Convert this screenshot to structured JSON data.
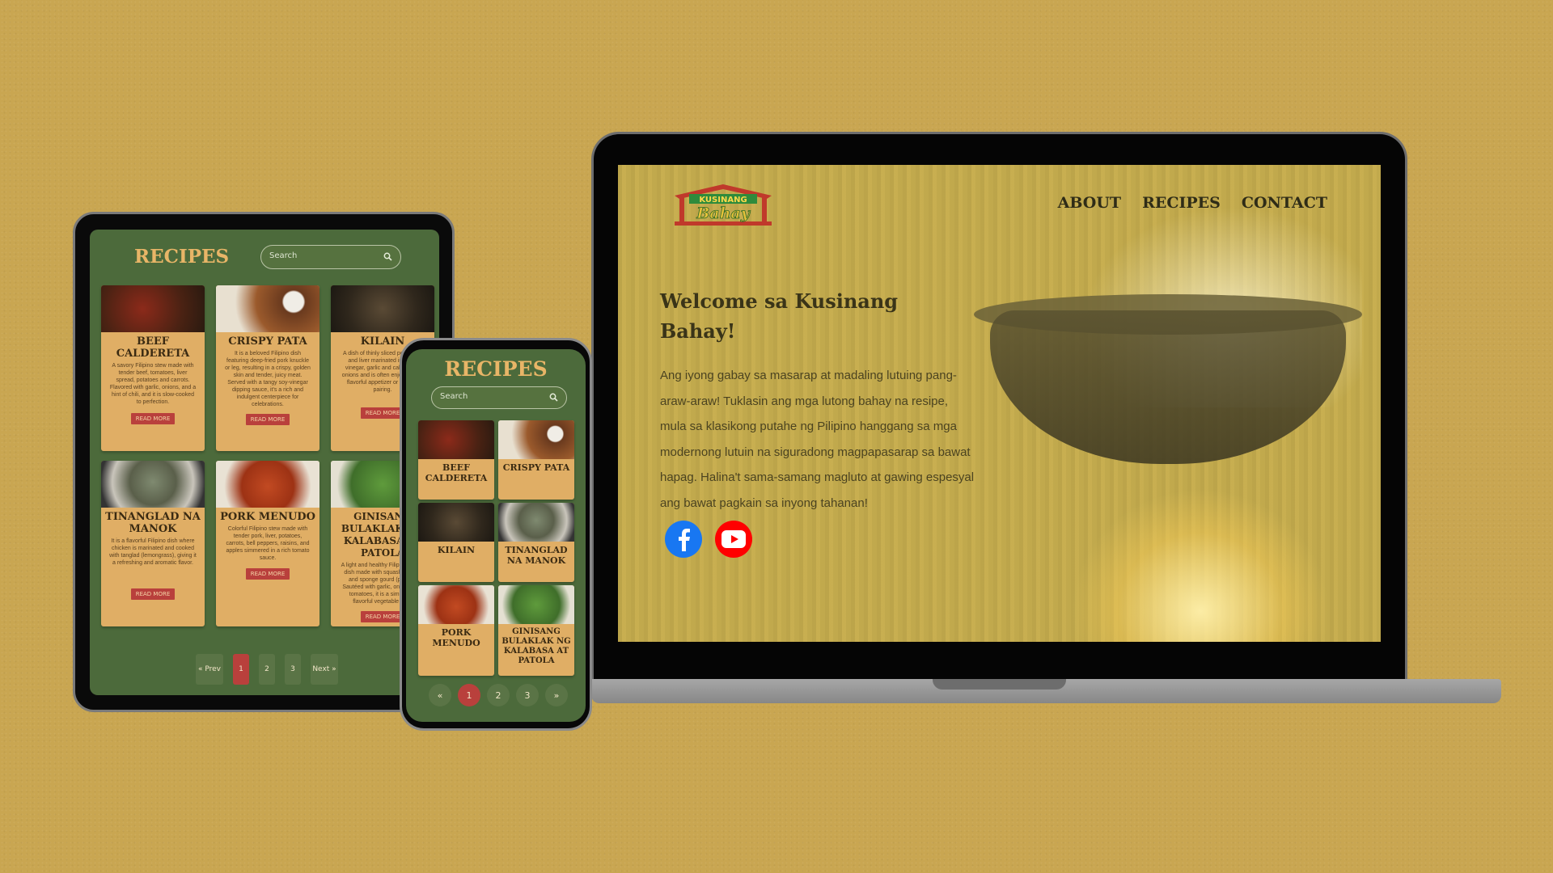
{
  "laptop": {
    "logo": {
      "line1": "KUSINANG",
      "line2": "Bahay"
    },
    "nav": [
      "ABOUT",
      "RECIPES",
      "CONTACT"
    ],
    "title": "Welcome sa Kusinang Bahay!",
    "text": "Ang iyong gabay sa masarap at madaling lutuing pang-araw-araw! Tuklasin ang mga lutong bahay na resipe, mula sa klasikong putahe ng Pilipino hanggang sa mga modernong lutuin na siguradong magpapasarap sa bawat hapag. Halina't sama-samang magluto at gawing espesyal ang bawat pagkain sa inyong tahanan!",
    "social": [
      "facebook-icon",
      "youtube-icon"
    ]
  },
  "tablet": {
    "title": "RECIPES",
    "search_placeholder": "Search",
    "cards": [
      {
        "name": "BEEF CALDERETA",
        "desc": "A savory Filipino stew made with tender beef, tomatoes, liver spread, potatoes and carrots. Flavored with garlic, onions, and a hint of chili, and it is slow-cooked to perfection.",
        "btn": "READ MORE"
      },
      {
        "name": "CRISPY PATA",
        "desc": "It is a beloved Filipino dish featuring deep-fried pork knuckle or leg, resulting in a crispy, golden skin and tender, juicy meat. Served with a tangy soy-vinegar dipping sauce, it's a rich and indulgent centerpiece for celebrations.",
        "btn": "READ MORE"
      },
      {
        "name": "KILAIN",
        "desc": "A dish of thinly sliced pork meat and liver marinated in white vinegar, garlic and calamansi, onions and is often enjoyed as a flavorful appetizer or pulutan pairing.",
        "btn": "READ MORE"
      },
      {
        "name": "TINANGLAD NA MANOK",
        "desc": "It is a flavorful Filipino dish where chicken is marinated and cooked with tanglad (lemongrass), giving it a refreshing and aromatic flavor.",
        "btn": "READ MORE"
      },
      {
        "name": "PORK MENUDO",
        "desc": "Colorful Filipino stew made with tender pork, liver, potatoes, carrots, bell peppers, raisins, and apples simmered in a rich tomato sauce.",
        "btn": "READ MORE"
      },
      {
        "name": "GINISANG BULAKLAK NG KALABASA AT PATOLA",
        "desc": "A light and healthy Filipino stir-fry dish made with squash flowers and sponge gourd (patola). Sautéed with garlic, onions, and tomatoes, it is a simple yet flavorful vegetable dish.",
        "btn": "READ MORE"
      }
    ],
    "pagination": [
      "« Prev",
      "1",
      "2",
      "3",
      "Next »"
    ]
  },
  "phone": {
    "title": "RECIPES",
    "search_placeholder": "Search",
    "cards": [
      "BEEF CALDERETA",
      "CRISPY PATA",
      "KILAIN",
      "TINANGLAD NA MANOK",
      "PORK MENUDO",
      "GINISANG BULAKLAK NG KALABASA AT PATOLA"
    ],
    "pagination": [
      "«",
      "1",
      "2",
      "3",
      "»"
    ]
  },
  "colors": {
    "background": "#c9a651",
    "screen_green": "#4c6a3b",
    "card": "#e0ae65",
    "title_gold": "#e8b567",
    "accent_red": "#b9403c"
  }
}
